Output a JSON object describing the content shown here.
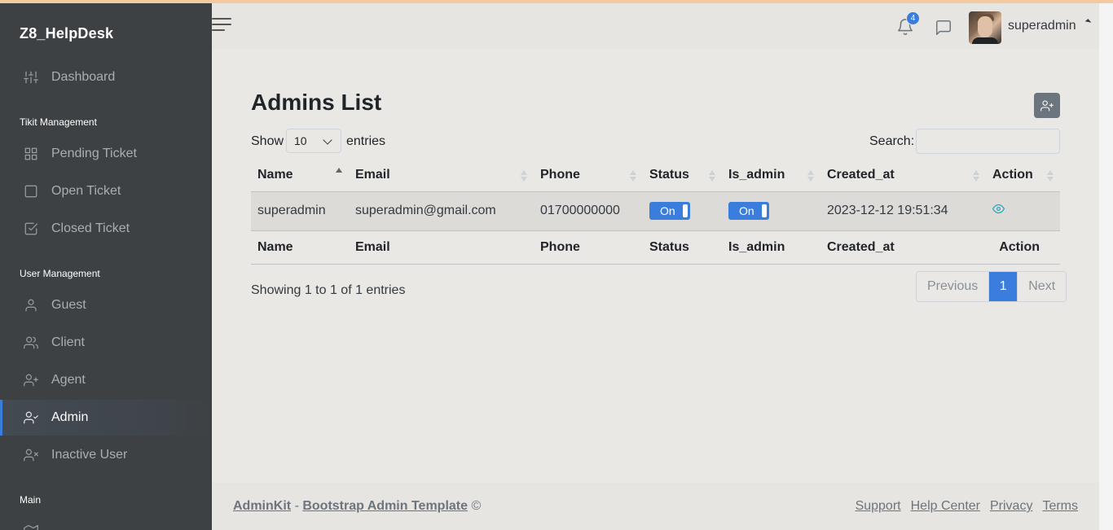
{
  "brand": "Z8_HelpDesk",
  "sidebar": {
    "dashboard": "Dashboard",
    "section_ticket": "Tikit Management",
    "pending": "Pending Ticket",
    "open": "Open Ticket",
    "closed": "Closed Ticket",
    "section_user": "User Management",
    "guest": "Guest",
    "client": "Client",
    "agent": "Agent",
    "admin": "Admin",
    "inactive": "Inactive User",
    "section_main": "Main"
  },
  "topbar": {
    "notification_count": "4",
    "username": "superadmin"
  },
  "page": {
    "title": "Admins List",
    "show_label": "Show",
    "entries_value": "10",
    "entries_label": "entries",
    "search_label": "Search:",
    "search_value": ""
  },
  "table": {
    "headers": [
      "Name",
      "Email",
      "Phone",
      "Status",
      "Is_admin",
      "Created_at",
      "Action"
    ],
    "rows": [
      {
        "name": "superadmin",
        "email": "superadmin@gmail.com",
        "phone": "01700000000",
        "status": "On",
        "is_admin": "On",
        "created_at": "2023-12-12 19:51:34"
      }
    ],
    "info": "Showing 1 to 1 of 1 entries",
    "pagination": {
      "previous": "Previous",
      "current": "1",
      "next": "Next"
    }
  },
  "footer": {
    "brand": "AdminKit",
    "sep": "-",
    "template": "Bootstrap Admin Template",
    "copy": "©",
    "links": [
      "Support",
      "Help Center",
      "Privacy",
      "Terms"
    ]
  },
  "colors": {
    "primary": "#3b7ddd",
    "sidebar": "#3d4144",
    "info": "#17a2b8"
  }
}
